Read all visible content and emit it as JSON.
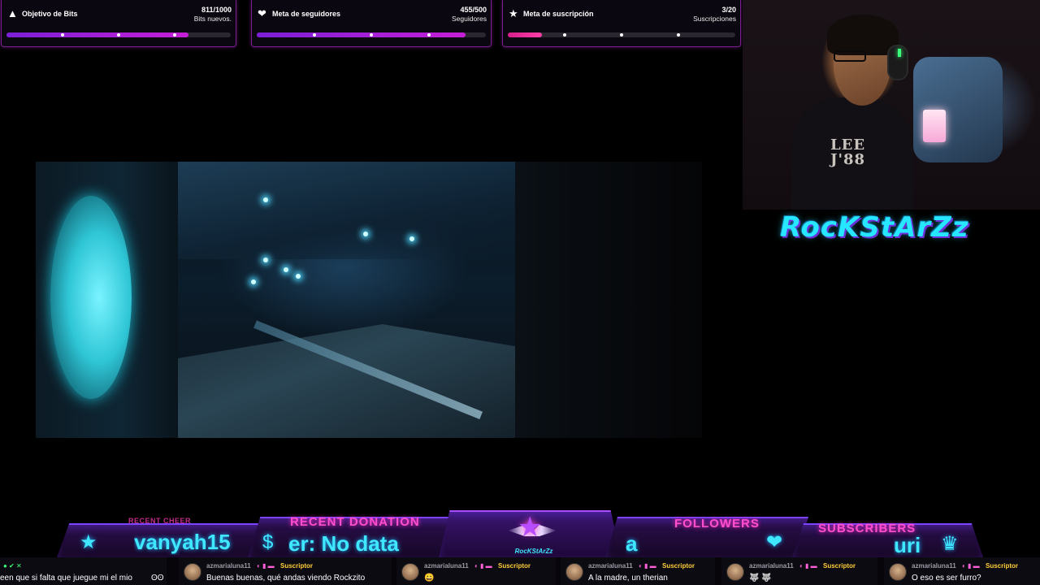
{
  "goals": [
    {
      "title": "Objetivo de Bits",
      "count": "811/1000",
      "sub": "Bits nuevos.",
      "icon": "bits-icon",
      "progress": 0.811
    },
    {
      "title": "Meta de seguidores",
      "count": "455/500",
      "sub": "Seguidores",
      "icon": "heart-icon",
      "progress": 0.91
    },
    {
      "title": "Meta de suscripción",
      "count": "3/20",
      "sub": "Suscripciones",
      "icon": "star-icon",
      "progress": 0.15
    }
  ],
  "webcam": {
    "shirt_text": "LEE\nJ'88"
  },
  "channel_logo": "RocKStArZz",
  "bottom_bar": {
    "recent_cheer": {
      "label": "RECENT CHEER",
      "value": "vanyah15"
    },
    "recent_donation": {
      "label": "RECENT DONATION",
      "value": "er: No data"
    },
    "center_logo_name": "RocKStArZz",
    "followers": {
      "label": "FOLLOWERS",
      "value": "a"
    },
    "subscribers": {
      "label": "SUBSCRIBERS",
      "value": "uri"
    }
  },
  "chat": [
    {
      "user": "",
      "text": "een que si falta que juegue mi el mio",
      "emote": "ʘʘ"
    },
    {
      "user": "azmarialuna11",
      "badge": "Suscriptor",
      "text": "Buenas buenas, qué andas viendo Rockzito"
    },
    {
      "user": "azmarialuna11",
      "badge": "Suscriptor",
      "text": "",
      "emote": "😀"
    },
    {
      "user": "azmarialuna11",
      "badge": "Suscriptor",
      "text": "A la madre, un therian"
    },
    {
      "user": "azmarialuna11",
      "badge": "Suscriptor",
      "text": "",
      "emote": "🐺 🐺"
    },
    {
      "user": "azmarialuna11",
      "badge": "Suscriptor",
      "text": "O eso es ser furro?"
    }
  ],
  "colors": {
    "accent_purple": "#7a1f8f",
    "neon_cyan": "#3fe8ff",
    "neon_pink": "#ff4fcf",
    "sub_gold": "#ffcf3a"
  }
}
